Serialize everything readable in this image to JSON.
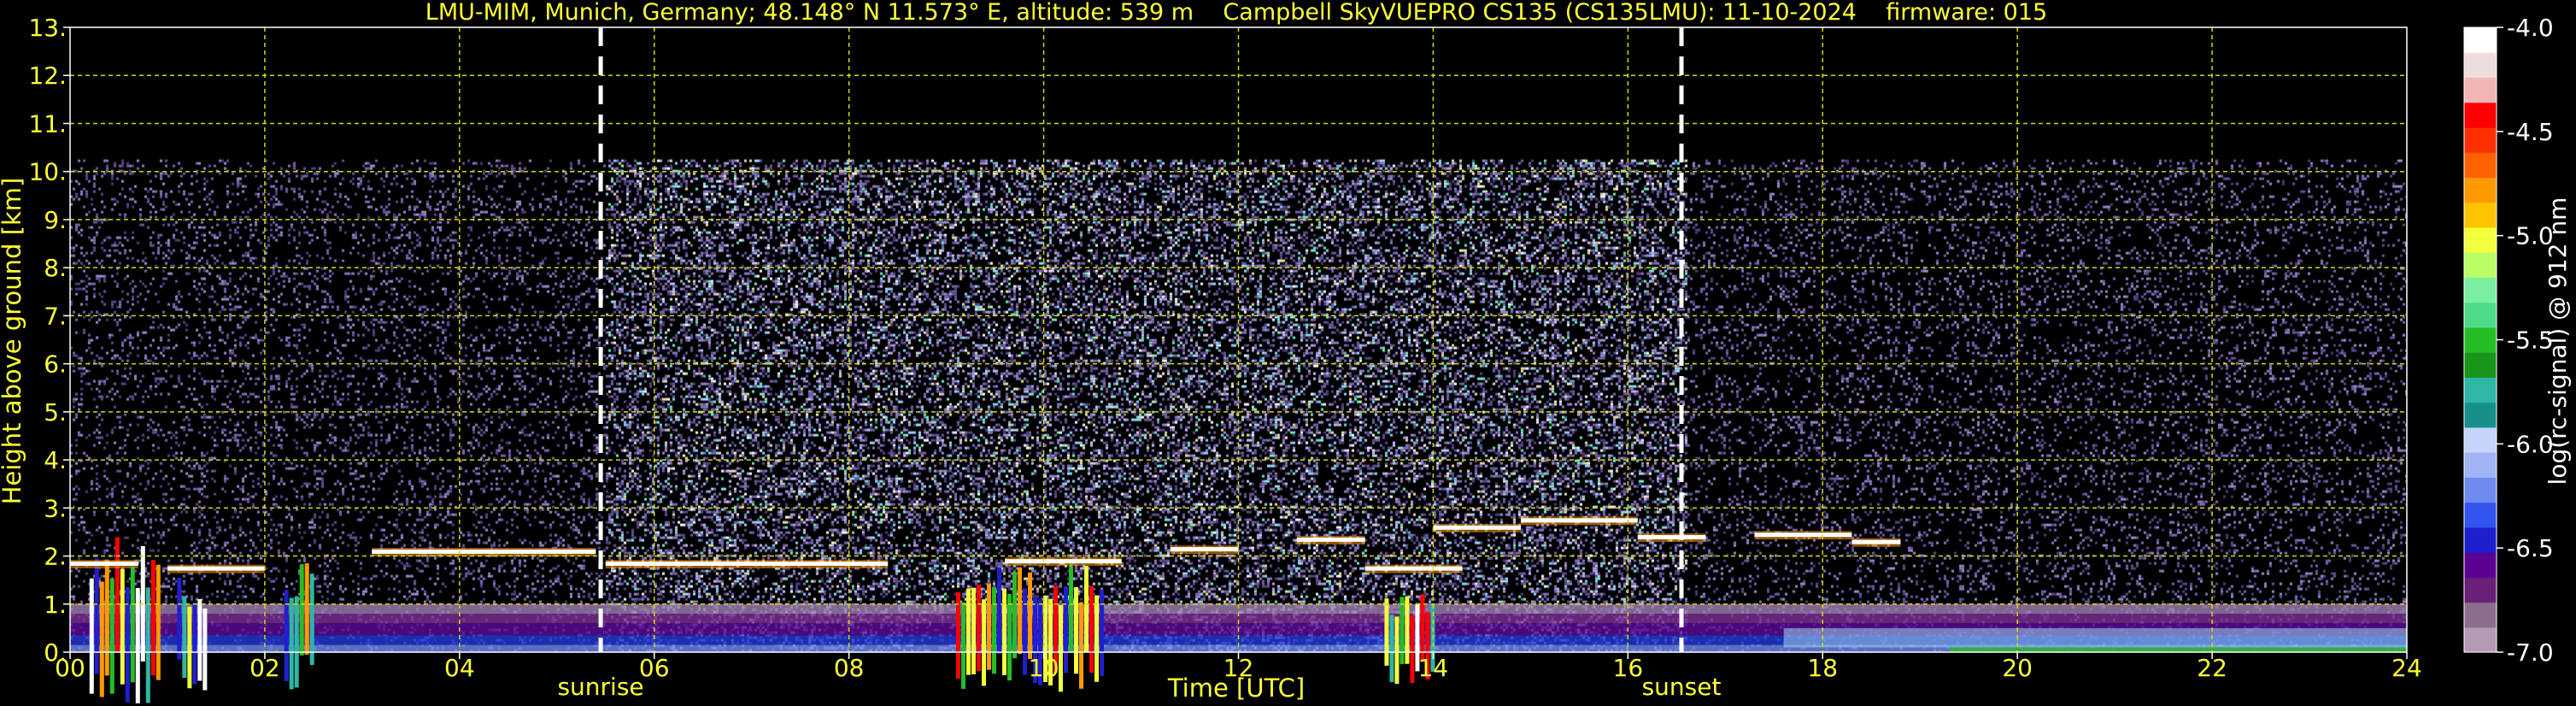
{
  "chart_data": {
    "type": "heatmap",
    "title_parts": [
      "LMU-MIM, Munich, Germany; 48.148° N 11.573° E, altitude: 539 m",
      "Campbell SkyVUEPRO CS135 (CS135LMU): 11-10-2024",
      "firmware: 015"
    ],
    "xlabel": "Time [UTC]",
    "ylabel": "Height above ground [km]",
    "x_ticks": [
      "00",
      "02",
      "04",
      "06",
      "08",
      "10",
      "12",
      "14",
      "16",
      "18",
      "20",
      "22",
      "24"
    ],
    "y_ticks": [
      "0.",
      "1.",
      "2.",
      "3.",
      "4.",
      "5.",
      "6.",
      "7.",
      "8.",
      "9.",
      "10.",
      "11.",
      "12.",
      "13."
    ],
    "xlim": [
      0,
      24
    ],
    "ylim": [
      0,
      13
    ],
    "grid": true,
    "annotations": [
      {
        "label": "sunrise",
        "x": 5.45
      },
      {
        "label": "sunset",
        "x": 16.55
      }
    ],
    "colorbar": {
      "label": "log(rc-signal) @ 912 nm",
      "ticks": [
        "-4.0",
        "-4.5",
        "-5.0",
        "-5.5",
        "-6.0",
        "-6.5",
        "-7.0"
      ],
      "range": [
        -7.0,
        -4.0
      ],
      "colors": [
        "#b39cb3",
        "#8c6d8c",
        "#6a1f78",
        "#5b0090",
        "#1f1fd0",
        "#3355ee",
        "#6f8bf0",
        "#9fb3f5",
        "#c6d3fa",
        "#17908c",
        "#2fb6a5",
        "#179619",
        "#25be25",
        "#4edb87",
        "#79f0a0",
        "#b8ff66",
        "#f2ff3c",
        "#ffc400",
        "#ff9900",
        "#ff6000",
        "#ff3000",
        "#ff0000",
        "#f2b5b5",
        "#eedddd",
        "#ffffff"
      ]
    },
    "signal_layers": [
      {
        "name": "noise",
        "y_range": [
          0,
          10.25
        ]
      },
      {
        "name": "boundary layer",
        "y_range": [
          0,
          1.0
        ]
      }
    ],
    "cloud_layers": [
      {
        "t": [
          0.0,
          0.7
        ],
        "h": 1.85
      },
      {
        "t": [
          1.0,
          2.0
        ],
        "h": 1.75
      },
      {
        "t": [
          3.1,
          5.4
        ],
        "h": 2.1
      },
      {
        "t": [
          5.5,
          8.4
        ],
        "h": 1.85
      },
      {
        "t": [
          9.6,
          10.8
        ],
        "h": 1.9
      },
      {
        "t": [
          11.3,
          12.0
        ],
        "h": 2.15
      },
      {
        "t": [
          12.6,
          13.3
        ],
        "h": 2.35
      },
      {
        "t": [
          13.3,
          14.3
        ],
        "h": 1.75
      },
      {
        "t": [
          14.0,
          14.9
        ],
        "h": 2.6
      },
      {
        "t": [
          14.9,
          16.1
        ],
        "h": 2.75
      },
      {
        "t": [
          16.1,
          16.8
        ],
        "h": 2.4
      },
      {
        "t": [
          17.3,
          18.3
        ],
        "h": 2.45
      },
      {
        "t": [
          18.3,
          18.8
        ],
        "h": 2.3
      }
    ],
    "precip_columns": [
      {
        "t": [
          0.2,
          0.9
        ],
        "top": 2.4
      },
      {
        "t": [
          1.1,
          1.4
        ],
        "top": 1.7
      },
      {
        "t": [
          2.2,
          2.5
        ],
        "top": 1.9
      },
      {
        "t": [
          9.1,
          10.6
        ],
        "top": 1.8
      },
      {
        "t": [
          13.5,
          14.0
        ],
        "top": 1.4
      }
    ]
  }
}
